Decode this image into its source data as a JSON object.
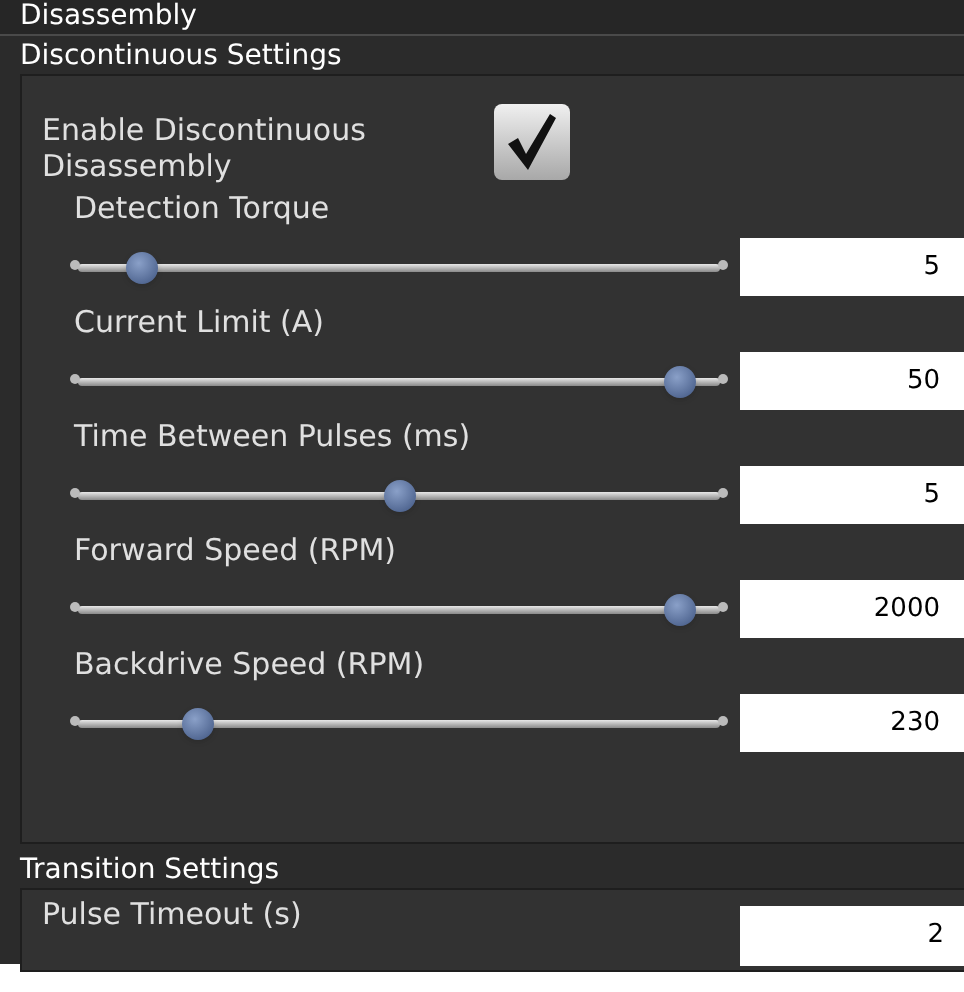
{
  "header": {
    "title": "Disassembly"
  },
  "discontinuous": {
    "title": "Discontinuous Settings",
    "enable": {
      "label": "Enable Discontinuous Disassembly",
      "checked": true
    },
    "sliders": [
      {
        "label": "Detection Torque",
        "level": 0.08,
        "value": "5"
      },
      {
        "label": "Current Limit (A)",
        "level": 0.96,
        "value": "50"
      },
      {
        "label": "Time Between Pulses (ms)",
        "level": 0.5,
        "value": "5"
      },
      {
        "label": "Forward Speed (RPM)",
        "level": 0.96,
        "value": "2000"
      },
      {
        "label": "Backdrive Speed (RPM)",
        "level": 0.17,
        "value": "230"
      }
    ]
  },
  "transition": {
    "title": "Transition Settings",
    "fields": [
      {
        "label": "Pulse Timeout (s)",
        "value": "2"
      }
    ]
  }
}
